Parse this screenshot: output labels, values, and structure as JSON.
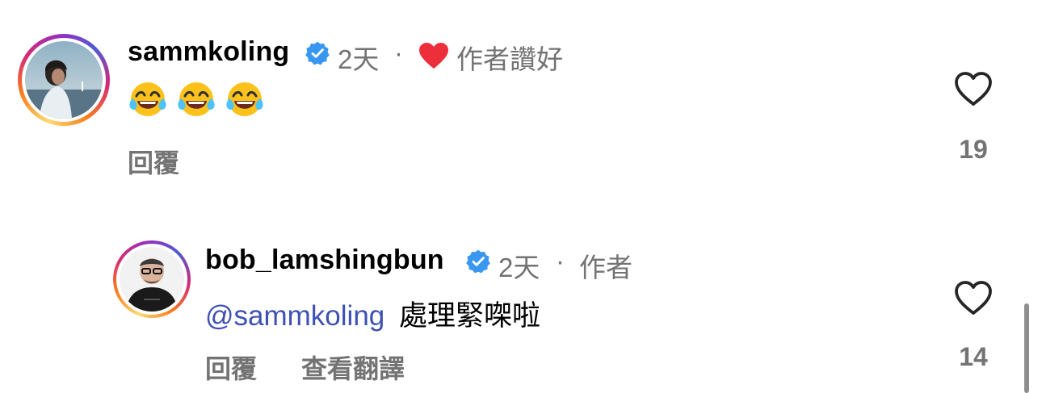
{
  "comments": [
    {
      "username": "sammkoling",
      "time": "2天",
      "dot": "·",
      "liked_by_author": "作者讚好",
      "text_emojis": [
        "face-with-tears-of-joy",
        "face-with-tears-of-joy",
        "face-with-tears-of-joy"
      ],
      "reply_label": "回覆",
      "like_count": "19"
    },
    {
      "username": "bob_lamshingbun",
      "time": "2天",
      "dot": "·",
      "author_badge": "作者",
      "mention": "@sammkoling",
      "text": "處理緊㗎啦",
      "reply_label": "回覆",
      "translate_label": "查看翻譯",
      "like_count": "14"
    }
  ],
  "colors": {
    "verified": "#3897f0",
    "heart": "#ed2f3b",
    "mention": "#3f51b5",
    "meta": "#737373"
  }
}
